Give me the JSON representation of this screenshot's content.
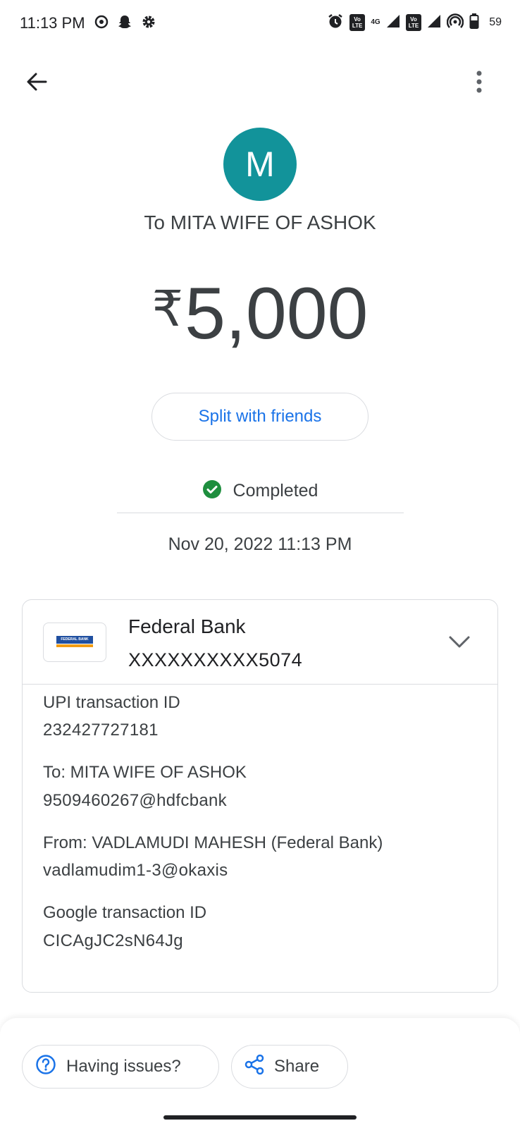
{
  "status_bar": {
    "time": "11:13 PM",
    "battery": "59",
    "network": "4G",
    "volte": "Vo LTE"
  },
  "header": {
    "avatar_letter": "M",
    "recipient_title": "To MITA WIFE OF ASHOK",
    "currency_symbol": "₹",
    "amount": "5,000"
  },
  "actions": {
    "split_label": "Split with friends"
  },
  "status": {
    "text": "Completed",
    "datetime": "Nov 20, 2022 11:13 PM"
  },
  "card": {
    "bank_name": "Federal Bank",
    "bank_logo_text": "FEDERAL BANK",
    "account": "XXXXXXXXXX5074",
    "details": [
      {
        "label": "UPI transaction ID",
        "value": "232427727181"
      },
      {
        "label": "To: MITA WIFE OF ASHOK",
        "value": "9509460267@hdfcbank"
      },
      {
        "label": "From: VADLAMUDI MAHESH (Federal Bank)",
        "value": "vadlamudim1-3@okaxis"
      },
      {
        "label": "Google transaction ID",
        "value": "CICAgJC2sN64Jg"
      }
    ]
  },
  "bottom": {
    "issues_label": "Having issues?",
    "share_label": "Share"
  },
  "colors": {
    "avatar": "#12939a",
    "link_blue": "#1a73e8",
    "success_green": "#1e8e3e",
    "text": "#3c4043"
  }
}
